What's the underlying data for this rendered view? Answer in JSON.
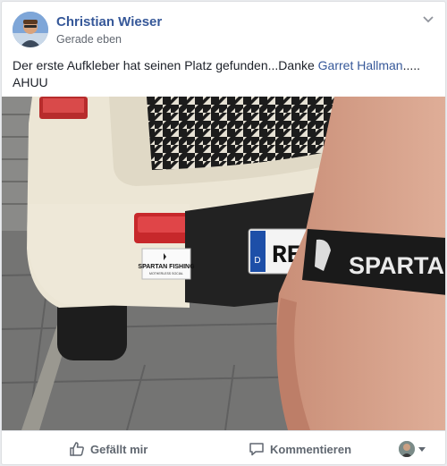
{
  "post": {
    "author": "Christian Wieser",
    "timestamp": "Gerade eben",
    "text_before": "Der erste Aufkleber hat seinen Platz gefunden...Danke ",
    "mention": "Garret Hallman",
    "text_after": "..... AHUU",
    "photo": {
      "sticker_title": "SPARTAN FISHING",
      "sticker_subtitle": "MOTHERLESS SOCIAL",
      "plate_country": "D",
      "plate_text": "RE",
      "wristband_text": "SPARTAN"
    }
  },
  "actions": {
    "like_label": "Gefällt mir",
    "comment_label": "Kommentieren"
  },
  "colors": {
    "link": "#365899",
    "secondary_text": "#616770",
    "action_text": "#606770"
  },
  "icons": {
    "like": "thumbs-up-icon",
    "comment": "speech-bubble-icon",
    "options": "chevron-down-icon"
  }
}
